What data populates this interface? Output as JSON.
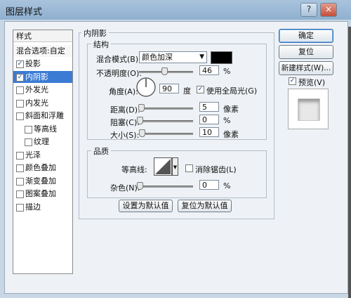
{
  "window": {
    "title": "图层样式",
    "controls": [
      "?",
      "×"
    ]
  },
  "styles_list": {
    "header": "样式",
    "blend_options": "混合选项:自定",
    "items": [
      {
        "label": "投影",
        "checked": true,
        "selected": false,
        "indent": false
      },
      {
        "label": "内阴影",
        "checked": true,
        "selected": true,
        "indent": false
      },
      {
        "label": "外发光",
        "checked": false,
        "selected": false,
        "indent": false
      },
      {
        "label": "内发光",
        "checked": false,
        "selected": false,
        "indent": false
      },
      {
        "label": "斜面和浮雕",
        "checked": false,
        "selected": false,
        "indent": false
      },
      {
        "label": "等高线",
        "checked": false,
        "selected": false,
        "indent": true
      },
      {
        "label": "纹理",
        "checked": false,
        "selected": false,
        "indent": true
      },
      {
        "label": "光泽",
        "checked": false,
        "selected": false,
        "indent": false
      },
      {
        "label": "颜色叠加",
        "checked": false,
        "selected": false,
        "indent": false
      },
      {
        "label": "渐变叠加",
        "checked": false,
        "selected": false,
        "indent": false
      },
      {
        "label": "图案叠加",
        "checked": false,
        "selected": false,
        "indent": false
      },
      {
        "label": "描边",
        "checked": false,
        "selected": false,
        "indent": false
      }
    ]
  },
  "inner_shadow": {
    "title": "内阴影",
    "structure": {
      "title": "结构",
      "blend_mode_label": "混合模式(B):",
      "blend_mode_value": "颜色加深",
      "shadow_color": "#000000",
      "opacity_label": "不透明度(O):",
      "opacity_value": "46",
      "opacity_unit": "%",
      "opacity_fraction": 0.46,
      "angle_label": "角度(A):",
      "angle_value": "90",
      "angle_unit": "度",
      "global_light_label": "使用全局光(G)",
      "global_light_checked": true,
      "distance_label": "距离(D):",
      "distance_value": "5",
      "distance_unit": "像素",
      "distance_fraction": 0.02,
      "choke_label": "阻塞(C):",
      "choke_value": "0",
      "choke_unit": "%",
      "choke_fraction": 0.0,
      "size_label": "大小(S):",
      "size_value": "10",
      "size_unit": "像素",
      "size_fraction": 0.04
    },
    "quality": {
      "title": "品质",
      "contour_label": "等高线:",
      "antialias_label": "消除锯齿(L)",
      "antialias_checked": false,
      "noise_label": "杂色(N):",
      "noise_value": "0",
      "noise_unit": "%",
      "noise_fraction": 0.0
    },
    "set_default_label": "设置为默认值",
    "reset_default_label": "复位为默认值"
  },
  "actions": {
    "ok_label": "确定",
    "reset_label": "复位",
    "new_style_label": "新建样式(W)...",
    "preview_label": "预览(V)",
    "preview_checked": true
  },
  "colors": {
    "accent": "#3b7bd4",
    "title_bar": "#9db9d6"
  }
}
